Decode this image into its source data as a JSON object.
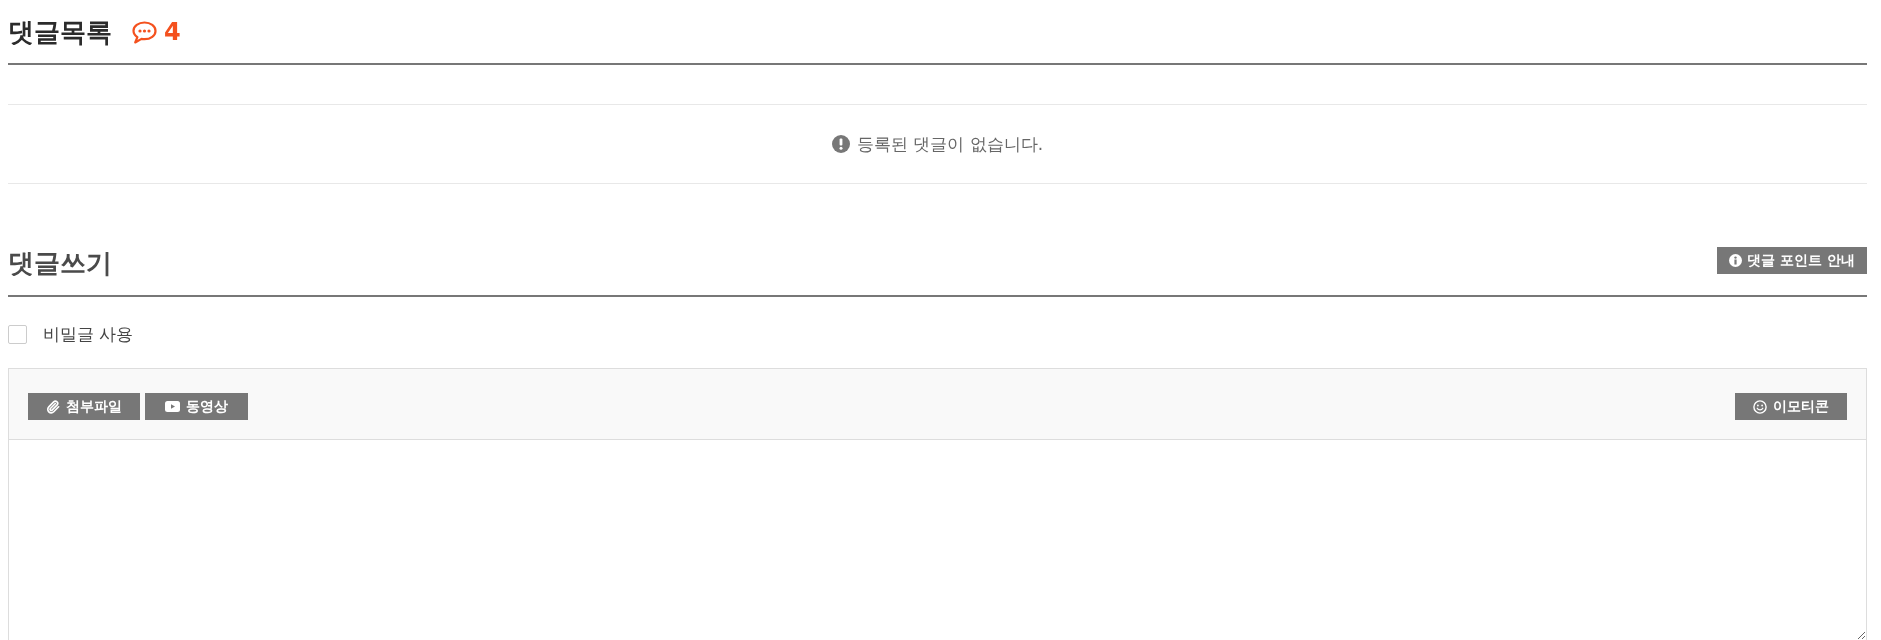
{
  "comment_list": {
    "title": "댓글목록",
    "count": "4",
    "empty_message": "등록된 댓글이 없습니다."
  },
  "comment_write": {
    "title": "댓글쓰기",
    "point_guide_button": "댓글 포인트 안내",
    "secret_option": {
      "label": "비밀글 사용",
      "checked": false
    },
    "toolbar": {
      "left_buttons": [
        {
          "kind": "attachment",
          "label": "첨부파일"
        },
        {
          "kind": "video",
          "label": "동영상"
        }
      ],
      "right_buttons": [
        {
          "kind": "emoticon",
          "label": "이모티콘"
        }
      ]
    }
  }
}
